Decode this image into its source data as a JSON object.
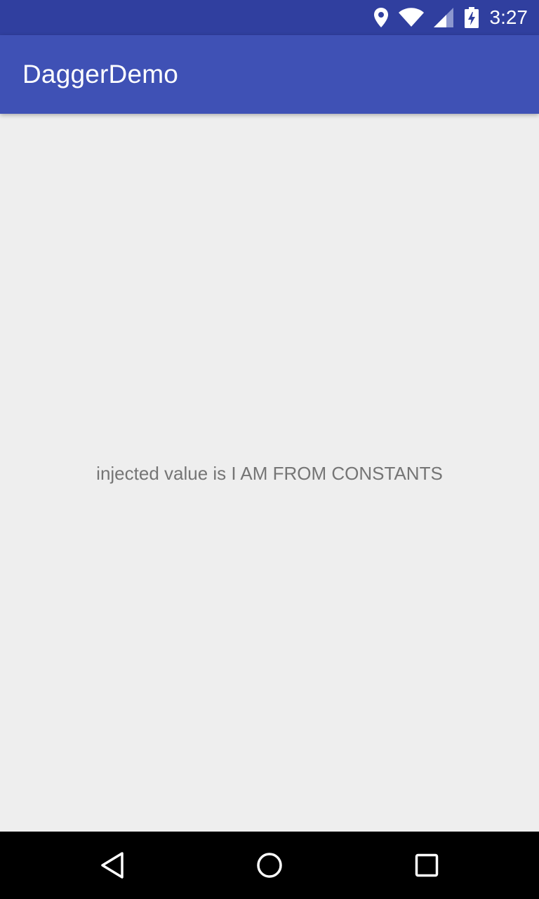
{
  "status_bar": {
    "time": "3:27",
    "icons": [
      "location-icon",
      "wifi-icon",
      "signal-icon",
      "battery-charging-icon"
    ],
    "color": "#303f9f"
  },
  "app_bar": {
    "title": "DaggerDemo",
    "color": "#3f51b5"
  },
  "main": {
    "message": "injected value is I AM FROM CONSTANTS"
  },
  "nav_bar": {
    "buttons": [
      "back-icon",
      "home-icon",
      "recents-icon"
    ]
  }
}
